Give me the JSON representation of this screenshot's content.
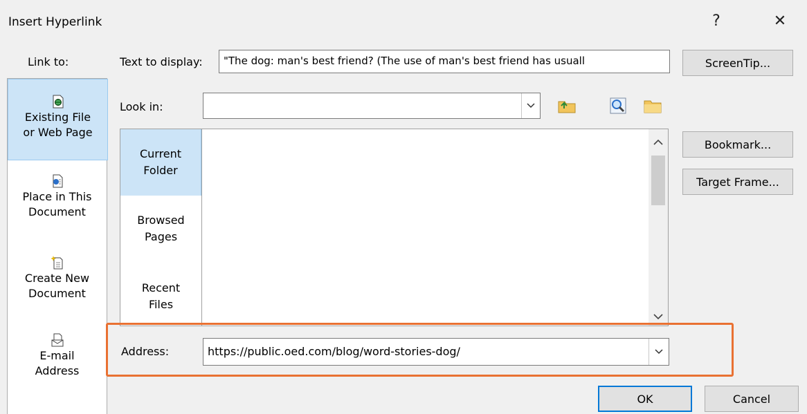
{
  "dialog": {
    "title": "Insert Hyperlink",
    "help_symbol": "?",
    "close_symbol": "✕"
  },
  "link_to": {
    "label": "Link to:",
    "items": [
      {
        "label_line1": "Existing File",
        "label_line2": "or Web Page",
        "icon": "existing-file-globe-icon",
        "selected": true
      },
      {
        "label_line1": "Place in This",
        "label_line2": "Document",
        "icon": "place-in-document-icon",
        "selected": false
      },
      {
        "label_line1": "Create New",
        "label_line2": "Document",
        "icon": "new-document-icon",
        "selected": false
      },
      {
        "label_line1": "E-mail",
        "label_line2": "Address",
        "icon": "email-icon",
        "selected": false
      }
    ]
  },
  "text_to_display": {
    "label": "Text to display:",
    "value": "\"The dog: man's best friend? (The use of man's best friend has usuall"
  },
  "look_in": {
    "label": "Look in:",
    "value": "",
    "icons": [
      "up-folder-icon",
      "browse-web-icon",
      "browse-file-icon"
    ]
  },
  "places": [
    {
      "line1": "Current",
      "line2": "Folder",
      "selected": true
    },
    {
      "line1": "Browsed",
      "line2": "Pages",
      "selected": false
    },
    {
      "line1": "Recent",
      "line2": "Files",
      "selected": false
    }
  ],
  "address": {
    "label": "Address:",
    "value": "https://public.oed.com/blog/word-stories-dog/"
  },
  "buttons": {
    "screentip": "ScreenTip...",
    "bookmark": "Bookmark...",
    "target_frame": "Target Frame...",
    "ok": "OK",
    "cancel": "Cancel"
  },
  "colors": {
    "highlight": "#e97132",
    "selection": "#cce4f7",
    "default_button_border": "#0078d7"
  }
}
